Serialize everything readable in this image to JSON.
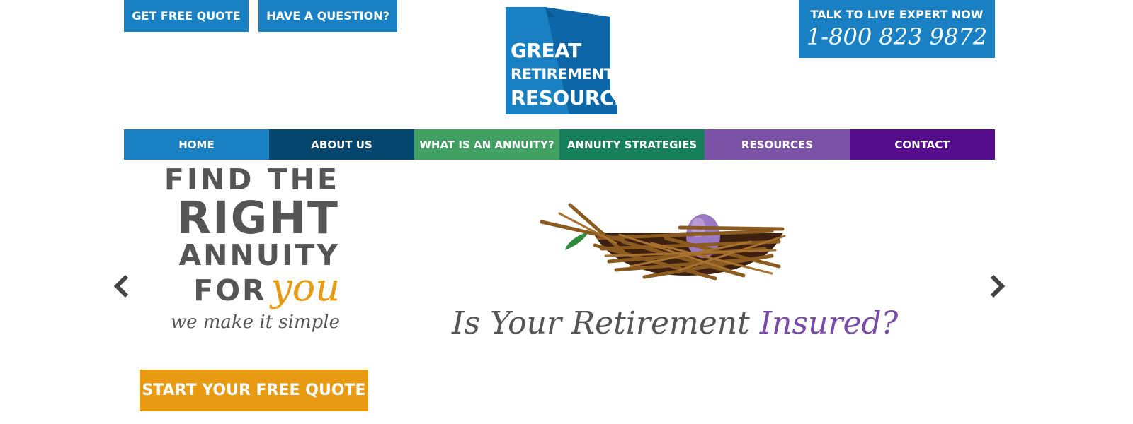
{
  "header": {
    "quote_button": "GET FREE QUOTE",
    "question_button": "HAVE A QUESTION?",
    "logo": {
      "line1": "GREAT",
      "line2": "RETIREMENT",
      "line3": "RESOURCES"
    },
    "expert": {
      "label": "TALK TO LIVE EXPERT NOW",
      "phone": "1-800 823 9872"
    }
  },
  "nav": {
    "items": [
      {
        "label": "HOME",
        "color": "#1a80c4"
      },
      {
        "label": "ABOUT US",
        "color": "#05466e"
      },
      {
        "label": "WHAT IS AN ANNUITY?",
        "color": "#41a162"
      },
      {
        "label": "ANNUITY STRATEGIES",
        "color": "#15805a"
      },
      {
        "label": "RESOURCES",
        "color": "#7b52a6"
      },
      {
        "label": "CONTACT",
        "color": "#560d8d"
      }
    ]
  },
  "hero": {
    "line1": "FIND THE",
    "line2": "RIGHT",
    "line3": "ANNUITY",
    "line4_a": "FOR",
    "line4_b": "you",
    "tagline": "we make it simple",
    "cta": "START YOUR FREE QUOTE",
    "question_a": "Is Your Retirement",
    "question_b": "Insured?"
  },
  "carousel": {
    "prev_icon": "chevron-left-icon",
    "next_icon": "chevron-right-icon"
  },
  "colors": {
    "brand_blue": "#1a80c4",
    "accent_orange": "#e89b12",
    "accent_purple": "#7a4aa8",
    "text_gray": "#555555"
  }
}
